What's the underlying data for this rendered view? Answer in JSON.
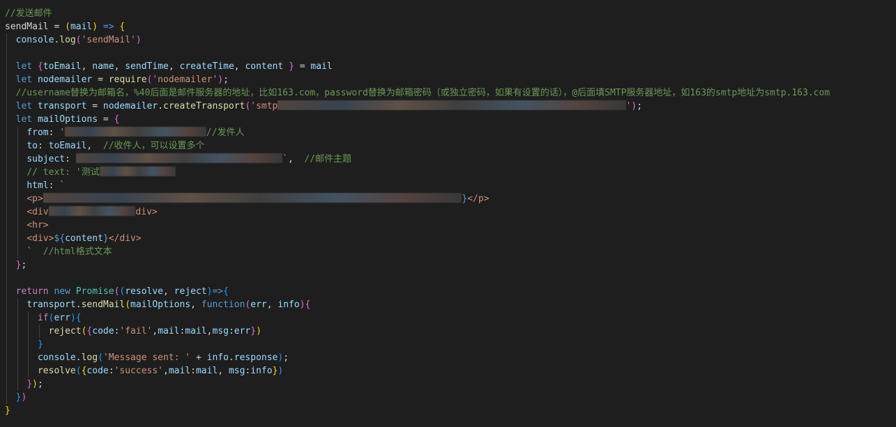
{
  "editor": {
    "background": "#1e1e1e",
    "lines": [
      {
        "indent": 0,
        "tokens": [
          {
            "t": "//发送邮件",
            "c": "comment"
          }
        ]
      },
      {
        "indent": 0,
        "tokens": [
          {
            "t": "sendMail",
            "c": "plain"
          },
          {
            "t": " = ",
            "c": "op"
          },
          {
            "t": "(",
            "c": "bracket1"
          },
          {
            "t": "mail",
            "c": "var"
          },
          {
            "t": ")",
            "c": "bracket1"
          },
          {
            "t": " ",
            "c": "plain"
          },
          {
            "t": "=>",
            "c": "keyword"
          },
          {
            "t": " ",
            "c": "plain"
          },
          {
            "t": "{",
            "c": "bracket1"
          }
        ]
      },
      {
        "indent": 1,
        "tokens": [
          {
            "t": "console",
            "c": "var"
          },
          {
            "t": ".",
            "c": "plain"
          },
          {
            "t": "log",
            "c": "func"
          },
          {
            "t": "(",
            "c": "bracket2"
          },
          {
            "t": "'sendMail'",
            "c": "string"
          },
          {
            "t": ")",
            "c": "bracket2"
          }
        ]
      },
      {
        "indent": 1,
        "tokens": []
      },
      {
        "indent": 1,
        "tokens": [
          {
            "t": "let",
            "c": "keyword"
          },
          {
            "t": " ",
            "c": "plain"
          },
          {
            "t": "{",
            "c": "bracket2"
          },
          {
            "t": "toEmail",
            "c": "var"
          },
          {
            "t": ", ",
            "c": "plain"
          },
          {
            "t": "name",
            "c": "var"
          },
          {
            "t": ", ",
            "c": "plain"
          },
          {
            "t": "sendTime",
            "c": "var"
          },
          {
            "t": ", ",
            "c": "plain"
          },
          {
            "t": "createTime",
            "c": "var"
          },
          {
            "t": ", ",
            "c": "plain"
          },
          {
            "t": "content",
            "c": "var"
          },
          {
            "t": " ",
            "c": "plain"
          },
          {
            "t": "}",
            "c": "bracket2"
          },
          {
            "t": " = ",
            "c": "op"
          },
          {
            "t": "mail",
            "c": "var"
          }
        ]
      },
      {
        "indent": 1,
        "tokens": [
          {
            "t": "let",
            "c": "keyword"
          },
          {
            "t": " ",
            "c": "plain"
          },
          {
            "t": "nodemailer",
            "c": "var"
          },
          {
            "t": " = ",
            "c": "op"
          },
          {
            "t": "require",
            "c": "func"
          },
          {
            "t": "(",
            "c": "bracket2"
          },
          {
            "t": "'nodemailer'",
            "c": "string"
          },
          {
            "t": ")",
            "c": "bracket2"
          },
          {
            "t": ";",
            "c": "plain"
          }
        ]
      },
      {
        "indent": 1,
        "tokens": [
          {
            "t": "//username替换为邮箱名，%40后面是邮件服务器的地址，比如163.com，password替换为邮箱密码（或独立密码，如果有设置的话），@后面填SMTP服务器地址，如163的smtp地址为smtp.163.com",
            "c": "comment"
          }
        ]
      },
      {
        "indent": 1,
        "tokens": [
          {
            "t": "let",
            "c": "keyword"
          },
          {
            "t": " ",
            "c": "plain"
          },
          {
            "t": "transport",
            "c": "var"
          },
          {
            "t": " = ",
            "c": "op"
          },
          {
            "t": "nodemailer",
            "c": "var"
          },
          {
            "t": ".",
            "c": "plain"
          },
          {
            "t": "createTransport",
            "c": "func"
          },
          {
            "t": "(",
            "c": "bracket2"
          },
          {
            "t": "'smtp",
            "c": "string"
          },
          {
            "r": 64
          },
          {
            "t": "'",
            "c": "string"
          },
          {
            "t": ")",
            "c": "bracket2"
          },
          {
            "t": ";",
            "c": "plain"
          }
        ]
      },
      {
        "indent": 1,
        "tokens": [
          {
            "t": "let",
            "c": "keyword"
          },
          {
            "t": " ",
            "c": "plain"
          },
          {
            "t": "mailOptions",
            "c": "var"
          },
          {
            "t": " = ",
            "c": "op"
          },
          {
            "t": "{",
            "c": "bracket2"
          }
        ]
      },
      {
        "indent": 2,
        "tokens": [
          {
            "t": "from",
            "c": "var"
          },
          {
            "t": ": ",
            "c": "plain"
          },
          {
            "t": "'",
            "c": "string"
          },
          {
            "r": 26
          },
          {
            "t": "//发件人",
            "c": "comment"
          }
        ]
      },
      {
        "indent": 2,
        "tokens": [
          {
            "t": "to",
            "c": "var"
          },
          {
            "t": ": ",
            "c": "plain"
          },
          {
            "t": "toEmail",
            "c": "var"
          },
          {
            "t": ",  ",
            "c": "plain"
          },
          {
            "t": "//收件人，可以设置多个",
            "c": "comment"
          }
        ]
      },
      {
        "indent": 2,
        "tokens": [
          {
            "t": "subject",
            "c": "var"
          },
          {
            "t": ": ",
            "c": "plain"
          },
          {
            "r": 38
          },
          {
            "t": "`",
            "c": "string"
          },
          {
            "t": ",  ",
            "c": "plain"
          },
          {
            "t": "//邮件主题",
            "c": "comment"
          }
        ]
      },
      {
        "indent": 2,
        "tokens": [
          {
            "t": "// text: '测试",
            "c": "comment"
          },
          {
            "r": 14
          }
        ]
      },
      {
        "indent": 2,
        "tokens": [
          {
            "t": "html",
            "c": "var"
          },
          {
            "t": ": ",
            "c": "plain"
          },
          {
            "t": "`",
            "c": "string"
          }
        ]
      },
      {
        "indent": 2,
        "tokens": [
          {
            "t": "<p>",
            "c": "string"
          },
          {
            "r": 77
          },
          {
            "t": "}",
            "c": "keyword"
          },
          {
            "t": "</p>",
            "c": "string"
          }
        ]
      },
      {
        "indent": 2,
        "tokens": [
          {
            "t": "<div",
            "c": "string"
          },
          {
            "r": 16
          },
          {
            "t": "div>",
            "c": "string"
          }
        ]
      },
      {
        "indent": 2,
        "tokens": [
          {
            "t": "<hr>",
            "c": "string"
          }
        ]
      },
      {
        "indent": 2,
        "tokens": [
          {
            "t": "<div>",
            "c": "string"
          },
          {
            "t": "${",
            "c": "keyword"
          },
          {
            "t": "content",
            "c": "var"
          },
          {
            "t": "}",
            "c": "keyword"
          },
          {
            "t": "</div>",
            "c": "string"
          }
        ]
      },
      {
        "indent": 2,
        "tokens": [
          {
            "t": "`",
            "c": "string"
          },
          {
            "t": "  ",
            "c": "plain"
          },
          {
            "t": "//html格式文本",
            "c": "comment"
          }
        ]
      },
      {
        "indent": 1,
        "tokens": [
          {
            "t": "}",
            "c": "bracket2"
          },
          {
            "t": ";",
            "c": "plain"
          }
        ]
      },
      {
        "indent": 1,
        "tokens": []
      },
      {
        "indent": 1,
        "tokens": [
          {
            "t": "return",
            "c": "control"
          },
          {
            "t": " ",
            "c": "plain"
          },
          {
            "t": "new",
            "c": "keyword"
          },
          {
            "t": " ",
            "c": "plain"
          },
          {
            "t": "Promise",
            "c": "class"
          },
          {
            "t": "(",
            "c": "bracket2"
          },
          {
            "t": "(",
            "c": "bracket3"
          },
          {
            "t": "resolve",
            "c": "var"
          },
          {
            "t": ", ",
            "c": "plain"
          },
          {
            "t": "reject",
            "c": "var"
          },
          {
            "t": ")",
            "c": "bracket3"
          },
          {
            "t": "=>",
            "c": "keyword"
          },
          {
            "t": "{",
            "c": "bracket3"
          }
        ]
      },
      {
        "indent": 2,
        "tokens": [
          {
            "t": "transport",
            "c": "var"
          },
          {
            "t": ".",
            "c": "plain"
          },
          {
            "t": "sendMail",
            "c": "func"
          },
          {
            "t": "(",
            "c": "bracket1"
          },
          {
            "t": "mailOptions",
            "c": "var"
          },
          {
            "t": ", ",
            "c": "plain"
          },
          {
            "t": "function",
            "c": "keyword"
          },
          {
            "t": "(",
            "c": "bracket2"
          },
          {
            "t": "err",
            "c": "var"
          },
          {
            "t": ", ",
            "c": "plain"
          },
          {
            "t": "info",
            "c": "var"
          },
          {
            "t": ")",
            "c": "bracket2"
          },
          {
            "t": "{",
            "c": "bracket2"
          }
        ]
      },
      {
        "indent": 3,
        "tokens": [
          {
            "t": "if",
            "c": "control"
          },
          {
            "t": "(",
            "c": "bracket3"
          },
          {
            "t": "err",
            "c": "var"
          },
          {
            "t": ")",
            "c": "bracket3"
          },
          {
            "t": "{",
            "c": "bracket3"
          }
        ]
      },
      {
        "indent": 4,
        "tokens": [
          {
            "t": "reject",
            "c": "func"
          },
          {
            "t": "(",
            "c": "bracket1"
          },
          {
            "t": "{",
            "c": "bracket2"
          },
          {
            "t": "code",
            "c": "var"
          },
          {
            "t": ":",
            "c": "plain"
          },
          {
            "t": "'fail'",
            "c": "string"
          },
          {
            "t": ",",
            "c": "plain"
          },
          {
            "t": "mail",
            "c": "var"
          },
          {
            "t": ":",
            "c": "plain"
          },
          {
            "t": "mail",
            "c": "var"
          },
          {
            "t": ",",
            "c": "plain"
          },
          {
            "t": "msg",
            "c": "var"
          },
          {
            "t": ":",
            "c": "plain"
          },
          {
            "t": "err",
            "c": "var"
          },
          {
            "t": "}",
            "c": "bracket2"
          },
          {
            "t": ")",
            "c": "bracket1"
          }
        ]
      },
      {
        "indent": 3,
        "tokens": [
          {
            "t": "}",
            "c": "bracket3"
          }
        ]
      },
      {
        "indent": 3,
        "tokens": [
          {
            "t": "console",
            "c": "var"
          },
          {
            "t": ".",
            "c": "plain"
          },
          {
            "t": "log",
            "c": "func"
          },
          {
            "t": "(",
            "c": "bracket3"
          },
          {
            "t": "'Message sent: '",
            "c": "string"
          },
          {
            "t": " + ",
            "c": "op"
          },
          {
            "t": "info",
            "c": "var"
          },
          {
            "t": ".",
            "c": "plain"
          },
          {
            "t": "response",
            "c": "var"
          },
          {
            "t": ")",
            "c": "bracket3"
          },
          {
            "t": ";",
            "c": "plain"
          }
        ]
      },
      {
        "indent": 3,
        "tokens": [
          {
            "t": "resolve",
            "c": "func"
          },
          {
            "t": "(",
            "c": "bracket3"
          },
          {
            "t": "{",
            "c": "bracket1"
          },
          {
            "t": "code",
            "c": "var"
          },
          {
            "t": ":",
            "c": "plain"
          },
          {
            "t": "'success'",
            "c": "string"
          },
          {
            "t": ",",
            "c": "plain"
          },
          {
            "t": "mail",
            "c": "var"
          },
          {
            "t": ":",
            "c": "plain"
          },
          {
            "t": "mail",
            "c": "var"
          },
          {
            "t": ", ",
            "c": "plain"
          },
          {
            "t": "msg",
            "c": "var"
          },
          {
            "t": ":",
            "c": "plain"
          },
          {
            "t": "info",
            "c": "var"
          },
          {
            "t": "}",
            "c": "bracket1"
          },
          {
            "t": ")",
            "c": "bracket3"
          }
        ]
      },
      {
        "indent": 2,
        "tokens": [
          {
            "t": "}",
            "c": "bracket2"
          },
          {
            "t": ")",
            "c": "bracket1"
          },
          {
            "t": ";",
            "c": "plain"
          }
        ]
      },
      {
        "indent": 1,
        "tokens": [
          {
            "t": "}",
            "c": "bracket3"
          },
          {
            "t": ")",
            "c": "bracket2"
          }
        ]
      },
      {
        "indent": 0,
        "tokens": [
          {
            "t": "}",
            "c": "bracket1"
          }
        ]
      }
    ]
  }
}
